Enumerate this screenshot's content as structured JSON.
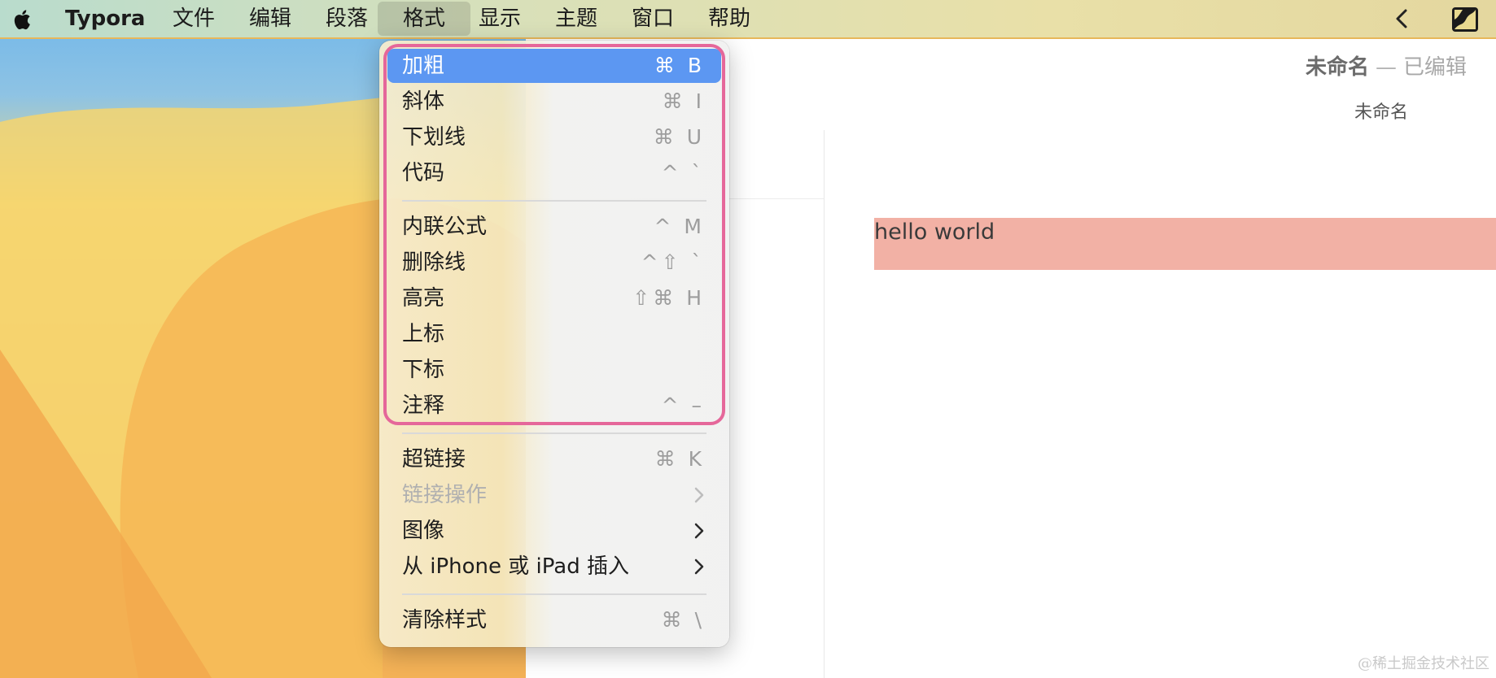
{
  "menubar": {
    "app_name": "Typora",
    "menus": [
      "文件",
      "编辑",
      "段落",
      "格式",
      "显示",
      "主题",
      "窗口",
      "帮助"
    ],
    "active_menu": "格式"
  },
  "document": {
    "title": "未命名",
    "separator": "—",
    "status": "已编辑",
    "tab_label": "未命名",
    "content_text": "hello world",
    "highlight_color": "#f2b1a5"
  },
  "format_menu": {
    "items": [
      {
        "label": "加粗",
        "shortcut": "⌘ B"
      },
      {
        "label": "斜体",
        "shortcut": "⌘ I"
      },
      {
        "label": "下划线",
        "shortcut": "⌘ U"
      },
      {
        "label": "代码",
        "shortcut": "^ `"
      },
      {
        "label": "内联公式",
        "shortcut": "^ M"
      },
      {
        "label": "删除线",
        "shortcut": "^⇧ `"
      },
      {
        "label": "高亮",
        "shortcut": "⇧⌘ H"
      },
      {
        "label": "上标",
        "shortcut": ""
      },
      {
        "label": "下标",
        "shortcut": ""
      },
      {
        "label": "注释",
        "shortcut": "^ –"
      },
      {
        "label": "超链接",
        "shortcut": "⌘ K"
      },
      {
        "label": "链接操作",
        "shortcut": ""
      },
      {
        "label": "图像",
        "shortcut": ""
      },
      {
        "label": "从 iPhone 或 iPad 插入",
        "shortcut": ""
      },
      {
        "label": "清除样式",
        "shortcut": "⌘ \\"
      }
    ],
    "selected_index": 0,
    "selection_color": "#5c97f2",
    "annotation_color": "#e5679a"
  },
  "watermark": "@稀土掘金技术社区"
}
